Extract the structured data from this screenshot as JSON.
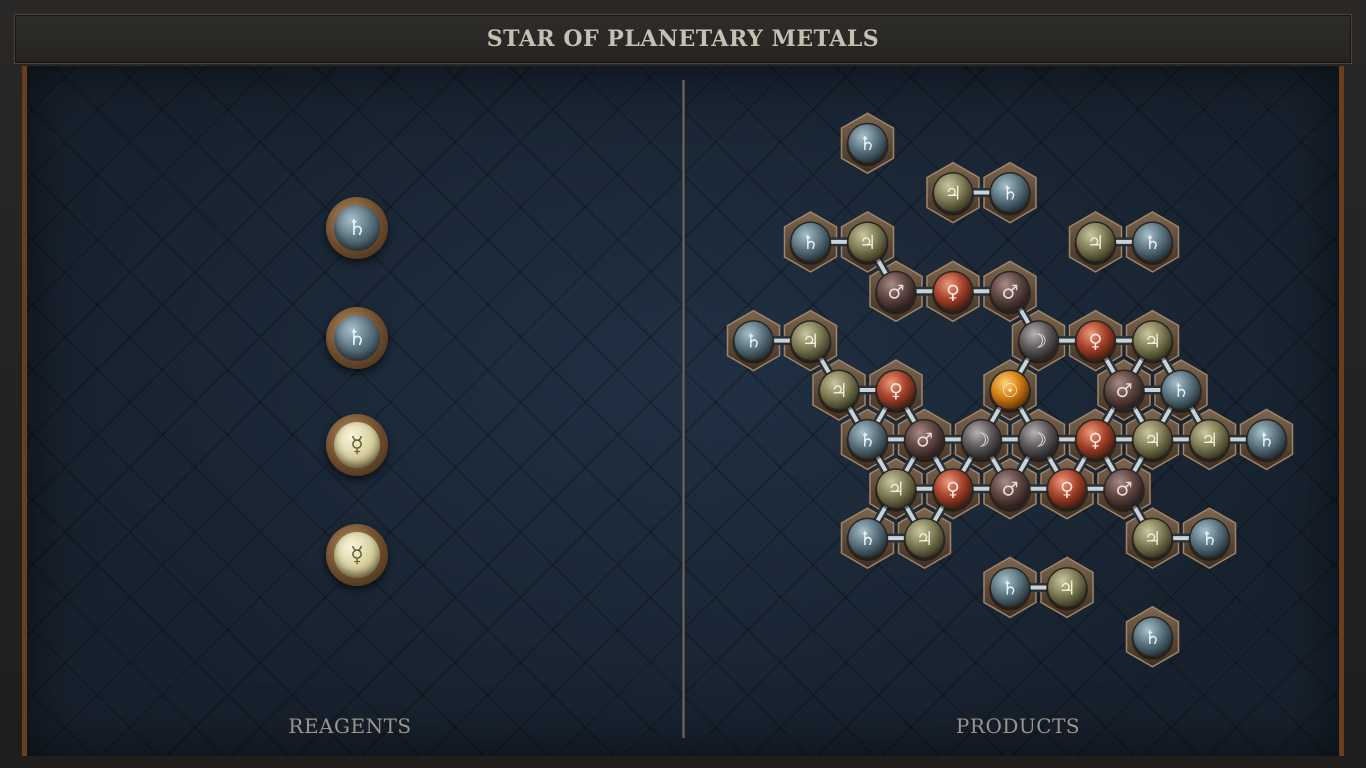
{
  "title": "STAR OF PLANETARY METALS",
  "panels": {
    "reagents_label": "REAGENTS",
    "products_label": "PRODUCTS"
  },
  "reagents": [
    {
      "element": "lead",
      "symbol": "♄"
    },
    {
      "element": "lead",
      "symbol": "♄"
    },
    {
      "element": "quicksilver",
      "symbol": "☿"
    },
    {
      "element": "quicksilver",
      "symbol": "☿"
    }
  ],
  "elements": {
    "lead": {
      "symbol": "♄",
      "hi": "#a9c0c8",
      "mid": "#5b7480",
      "lo": "#26343b",
      "fg": "#eaf4f7"
    },
    "tin": {
      "symbol": "♃",
      "hi": "#c9c6a0",
      "mid": "#7f7c56",
      "lo": "#3b3a24",
      "fg": "#f3f0d8"
    },
    "iron": {
      "symbol": "♂",
      "hi": "#a88b86",
      "mid": "#5e4643",
      "lo": "#2a1e1c",
      "fg": "#eedbd6"
    },
    "copper": {
      "symbol": "♀",
      "hi": "#ef9a7c",
      "mid": "#a6422a",
      "lo": "#4c1c10",
      "fg": "#fde9de"
    },
    "silver": {
      "symbol": "☽",
      "hi": "#b6b2b2",
      "mid": "#5e5a5c",
      "lo": "#262426",
      "fg": "#f3f1f1"
    },
    "gold": {
      "symbol": "☉",
      "hi": "#ffd27a",
      "mid": "#d37e14",
      "lo": "#6a3606",
      "fg": "#fff0cf"
    }
  },
  "product_atoms": [
    {
      "element": "lead",
      "q": 0,
      "r": -5
    },
    {
      "element": "lead",
      "q": -2,
      "r": -3
    },
    {
      "element": "tin",
      "q": -1,
      "r": -3
    },
    {
      "element": "tin",
      "q": 1,
      "r": -4
    },
    {
      "element": "lead",
      "q": 2,
      "r": -4
    },
    {
      "element": "lead",
      "q": -4,
      "r": -1
    },
    {
      "element": "tin",
      "q": -3,
      "r": -1
    },
    {
      "element": "iron",
      "q": -1,
      "r": -2
    },
    {
      "element": "copper",
      "q": 0,
      "r": -2
    },
    {
      "element": "iron",
      "q": 1,
      "r": -2
    },
    {
      "element": "tin",
      "q": 3,
      "r": -3
    },
    {
      "element": "lead",
      "q": 4,
      "r": -3
    },
    {
      "element": "tin",
      "q": -3,
      "r": 0
    },
    {
      "element": "copper",
      "q": -2,
      "r": 0
    },
    {
      "element": "silver",
      "q": 1,
      "r": -1
    },
    {
      "element": "copper",
      "q": 2,
      "r": -1
    },
    {
      "element": "tin",
      "q": 3,
      "r": -1
    },
    {
      "element": "lead",
      "q": -3,
      "r": 1
    },
    {
      "element": "iron",
      "q": -2,
      "r": 1
    },
    {
      "element": "silver",
      "q": -1,
      "r": 1
    },
    {
      "element": "gold",
      "q": 0,
      "r": 0
    },
    {
      "element": "iron",
      "q": 2,
      "r": 0
    },
    {
      "element": "lead",
      "q": 3,
      "r": 0
    },
    {
      "element": "tin",
      "q": -3,
      "r": 2
    },
    {
      "element": "copper",
      "q": -2,
      "r": 2
    },
    {
      "element": "silver",
      "q": 0,
      "r": 1
    },
    {
      "element": "copper",
      "q": 1,
      "r": 1
    },
    {
      "element": "tin",
      "q": 2,
      "r": 1
    },
    {
      "element": "lead",
      "q": -4,
      "r": 3
    },
    {
      "element": "tin",
      "q": -3,
      "r": 3
    },
    {
      "element": "iron",
      "q": -1,
      "r": 2
    },
    {
      "element": "copper",
      "q": 0,
      "r": 2
    },
    {
      "element": "iron",
      "q": 1,
      "r": 2
    },
    {
      "element": "tin",
      "q": 3,
      "r": 1
    },
    {
      "element": "lead",
      "q": 4,
      "r": 1
    },
    {
      "element": "lead",
      "q": -2,
      "r": 4
    },
    {
      "element": "tin",
      "q": -1,
      "r": 4
    },
    {
      "element": "tin",
      "q": 1,
      "r": 3
    },
    {
      "element": "lead",
      "q": 2,
      "r": 3
    },
    {
      "element": "lead",
      "q": 0,
      "r": 5
    }
  ]
}
